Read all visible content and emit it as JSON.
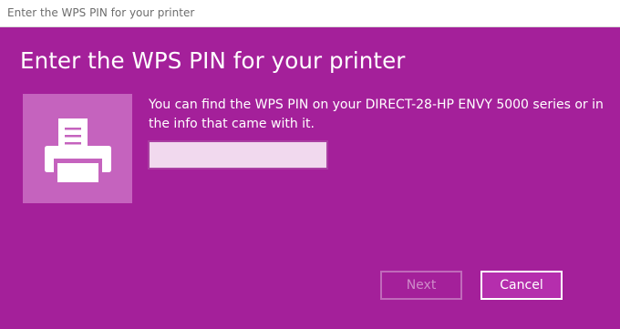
{
  "window": {
    "title": "Enter the WPS PIN for your printer"
  },
  "dialog": {
    "heading": "Enter the WPS PIN for your printer",
    "description": "You can find the WPS PIN on your DIRECT-28-HP ENVY 5000 series or in the info that came with it.",
    "pin_input": {
      "value": "",
      "placeholder": ""
    },
    "icon": "printer-icon"
  },
  "buttons": {
    "next_label": "Next",
    "next_enabled": false,
    "cancel_label": "Cancel"
  },
  "colors": {
    "accent": "#a4209a",
    "tile": "#c563be",
    "input_bg": "#f1d9ee",
    "titlebar_bg": "#ffffff"
  }
}
